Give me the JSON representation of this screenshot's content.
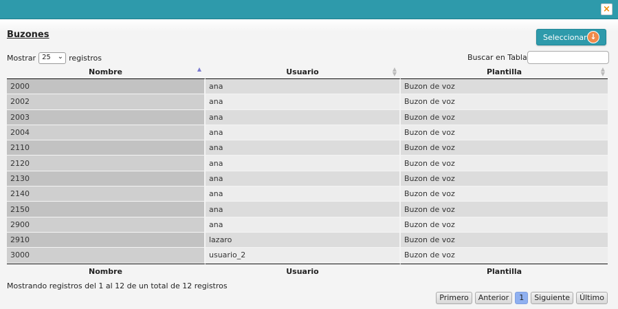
{
  "dialog": {
    "close_label": "×"
  },
  "header": {
    "title": "Buzones",
    "select_button_label": "Seleccionar"
  },
  "length": {
    "prefix": "Mostrar",
    "selected": "25",
    "suffix": "registros"
  },
  "search": {
    "label": "Buscar en Tabla:",
    "value": "",
    "placeholder": ""
  },
  "table": {
    "columns": [
      "Nombre",
      "Usuario",
      "Plantilla"
    ],
    "sorted_column": "Nombre",
    "sort_direction": "ascending",
    "rows": [
      [
        "2000",
        "ana",
        "Buzon de voz"
      ],
      [
        "2002",
        "ana",
        "Buzon de voz"
      ],
      [
        "2003",
        "ana",
        "Buzon de voz"
      ],
      [
        "2004",
        "ana",
        "Buzon de voz"
      ],
      [
        "2110",
        "ana",
        "Buzon de voz"
      ],
      [
        "2120",
        "ana",
        "Buzon de voz"
      ],
      [
        "2130",
        "ana",
        "Buzon de voz"
      ],
      [
        "2140",
        "ana",
        "Buzon de voz"
      ],
      [
        "2150",
        "ana",
        "Buzon de voz"
      ],
      [
        "2900",
        "ana",
        "Buzon de voz"
      ],
      [
        "2910",
        "lazaro",
        "Buzon de voz"
      ],
      [
        "3000",
        "usuario_2",
        "Buzon de voz"
      ]
    ]
  },
  "info": "Mostrando registros del 1 al 12 de un total de 12 registros",
  "pagination": {
    "first": "Primero",
    "previous": "Anterior",
    "current": "1",
    "next": "Siguiente",
    "last": "Último"
  },
  "colors": {
    "titlebar": "#2e9aab",
    "accent": "#f08a00",
    "active_page": "#8fb0f0"
  }
}
